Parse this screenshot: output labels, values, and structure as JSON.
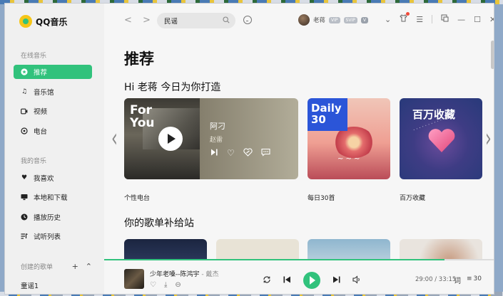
{
  "app": {
    "name": "QQ音乐"
  },
  "sidebar": {
    "sections": [
      {
        "title": "在线音乐",
        "items": [
          {
            "label": "推荐",
            "icon": "star-icon",
            "active": true
          },
          {
            "label": "音乐馆",
            "icon": "music-note-icon"
          },
          {
            "label": "视频",
            "icon": "video-icon"
          },
          {
            "label": "电台",
            "icon": "radio-icon"
          }
        ]
      },
      {
        "title": "我的音乐",
        "items": [
          {
            "label": "我喜欢",
            "icon": "heart-icon"
          },
          {
            "label": "本地和下载",
            "icon": "monitor-icon"
          },
          {
            "label": "播放历史",
            "icon": "clock-icon"
          },
          {
            "label": "试听列表",
            "icon": "playlist-icon"
          }
        ]
      }
    ],
    "created_title": "创建的歌单",
    "created_items": [
      "童谣1"
    ]
  },
  "search": {
    "value": "民谣"
  },
  "user": {
    "name": "老蒋",
    "badges": [
      "VIP",
      "SVIP",
      "V"
    ]
  },
  "main": {
    "title": "推荐",
    "greeting": "Hi 老蒋 今日为你打造",
    "radio": {
      "cover_text_1": "For",
      "cover_text_2": "You",
      "song": "阿刁",
      "singer": "赵雷",
      "label": "个性电台"
    },
    "daily": {
      "cover_text_1": "Daily",
      "cover_text_2": "30",
      "label": "每日30首"
    },
    "million": {
      "cover_text": "百万收藏",
      "label": "百万收藏"
    },
    "section2_title": "你的歌单补给站"
  },
  "player": {
    "song": "少年老嗓--陈鸿宇",
    "separator": " - ",
    "artist": "戴杰",
    "current_time": "29:00",
    "total_time": "33:15",
    "progress": 0.87,
    "lyric_label": "词",
    "playlist_count": "30"
  },
  "colors": {
    "accent": "#31c27c"
  }
}
